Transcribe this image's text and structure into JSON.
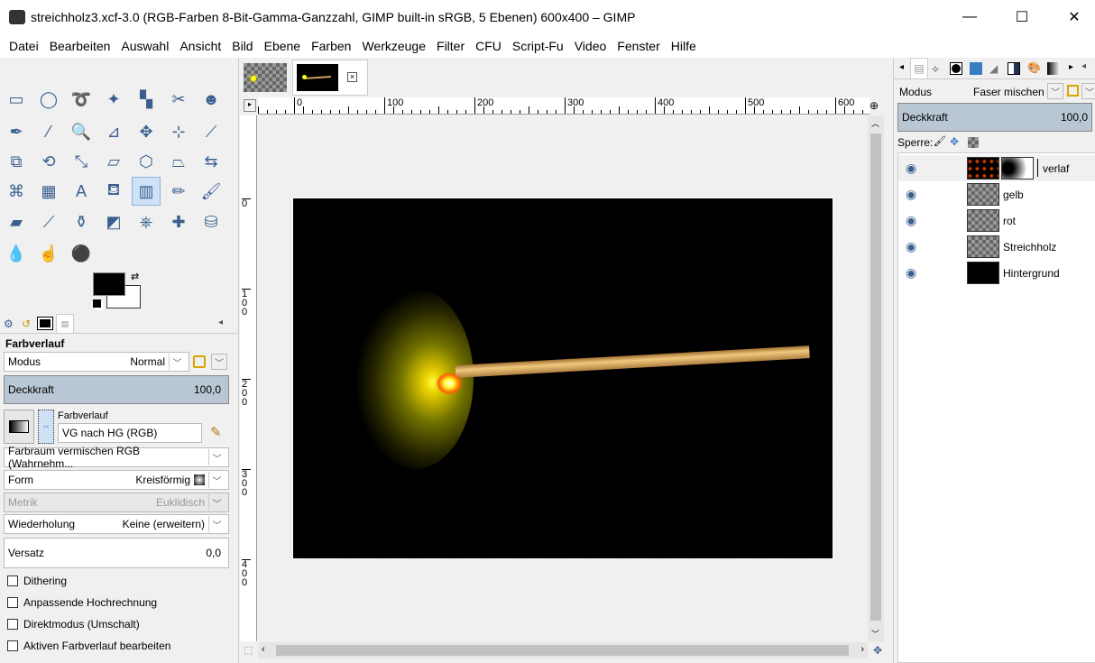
{
  "window": {
    "title": "streichholz3.xcf-3.0 (RGB-Farben 8-Bit-Gamma-Ganzzahl, GIMP built-in sRGB, 5 Ebenen) 600x400 – GIMP",
    "minimize": "—",
    "maximize": "☐",
    "close": "✕"
  },
  "menu": [
    "Datei",
    "Bearbeiten",
    "Auswahl",
    "Ansicht",
    "Bild",
    "Ebene",
    "Farben",
    "Werkzeuge",
    "Filter",
    "CFU",
    "Script-Fu",
    "Video",
    "Fenster",
    "Hilfe"
  ],
  "tools": [
    {
      "name": "rect-select",
      "g": "▭"
    },
    {
      "name": "ellipse-select",
      "g": "◯"
    },
    {
      "name": "free-select",
      "g": "➰"
    },
    {
      "name": "fuzzy-select",
      "g": "✦"
    },
    {
      "name": "select-by-color",
      "g": "▚"
    },
    {
      "name": "scissors",
      "g": "✂"
    },
    {
      "name": "foreground-select",
      "g": "☻"
    },
    {
      "name": "paths",
      "g": "✒"
    },
    {
      "name": "color-picker",
      "g": "⁄"
    },
    {
      "name": "zoom",
      "g": "🔍"
    },
    {
      "name": "measure",
      "g": "⊿"
    },
    {
      "name": "move",
      "g": "✥"
    },
    {
      "name": "alignment",
      "g": "⊹"
    },
    {
      "name": "crop",
      "g": "⟋"
    },
    {
      "name": "unified-transform",
      "g": "⧉"
    },
    {
      "name": "rotate",
      "g": "⟲"
    },
    {
      "name": "scale",
      "g": "⤡"
    },
    {
      "name": "shear",
      "g": "▱"
    },
    {
      "name": "cage",
      "g": "⬡"
    },
    {
      "name": "perspective",
      "g": "⏢"
    },
    {
      "name": "flip",
      "g": "⇆"
    },
    {
      "name": "warp",
      "g": "⌘"
    },
    {
      "name": "gradient-checker",
      "g": "▦"
    },
    {
      "name": "text",
      "g": "A"
    },
    {
      "name": "bucket-fill",
      "g": "⛾"
    },
    {
      "name": "gradient",
      "g": "▥"
    },
    {
      "name": "pencil",
      "g": "✏"
    },
    {
      "name": "paintbrush",
      "g": "🖌"
    },
    {
      "name": "eraser",
      "g": "▰"
    },
    {
      "name": "airbrush",
      "g": "⟋"
    },
    {
      "name": "ink",
      "g": "⚱"
    },
    {
      "name": "mypaint-brush",
      "g": "◩"
    },
    {
      "name": "clone",
      "g": "⎈"
    },
    {
      "name": "heal",
      "g": "✚"
    },
    {
      "name": "perspective-clone",
      "g": "⛁"
    },
    {
      "name": "blur",
      "g": "💧"
    },
    {
      "name": "smudge",
      "g": "☝"
    },
    {
      "name": "dodge-burn",
      "g": "⚫"
    }
  ],
  "colors": {
    "fg": "#000000",
    "bg": "#ffffff"
  },
  "tool_options": {
    "title": "Farbverlauf",
    "mode_label": "Modus",
    "mode_value": "Normal",
    "opacity_label": "Deckkraft",
    "opacity_value": "100,0",
    "gradient_label": "Farbverlauf",
    "gradient_value": "VG nach HG (RGB)",
    "blend_space": "Farbraum vermischen RGB (Wahrnehm...",
    "shape_label": "Form",
    "shape_value": "Kreisförmig",
    "metric_label": "Metrik",
    "metric_value": "Euklidisch",
    "repeat_label": "Wiederholung",
    "repeat_value": "Keine (erweitern)",
    "offset_label": "Versatz",
    "offset_value": "0,0",
    "checks": [
      "Dithering",
      "Anpassende Hochrechnung",
      "Direktmodus (Umschalt)",
      "Aktiven Farbverlauf bearbeiten"
    ]
  },
  "ruler": {
    "top": [
      "0",
      "100",
      "200",
      "300",
      "400",
      "500",
      "600"
    ],
    "left": [
      "0",
      "100",
      "200",
      "300",
      "400"
    ]
  },
  "layers_panel": {
    "mode_label": "Modus",
    "mode_value": "Faser mischen",
    "opacity_label": "Deckkraft",
    "opacity_value": "100,0",
    "lock_label": "Sperre:",
    "layers": [
      {
        "name": "verlaf",
        "editing": true
      },
      {
        "name": "gelb"
      },
      {
        "name": "rot"
      },
      {
        "name": "Streichholz"
      },
      {
        "name": "Hintergrund"
      }
    ]
  }
}
